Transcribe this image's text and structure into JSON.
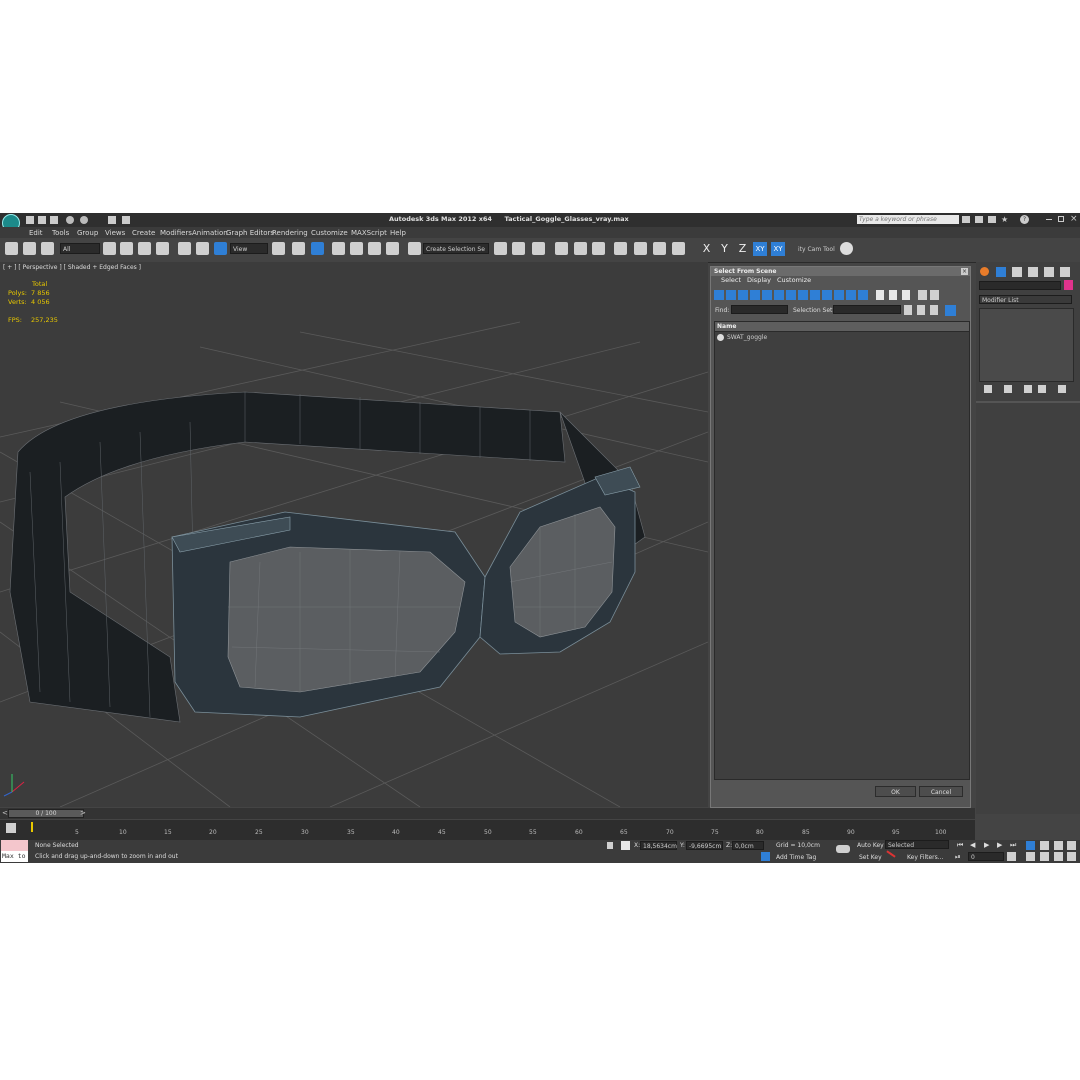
{
  "title": {
    "app": "Autodesk 3ds Max  2012 x64",
    "file": "Tactical_Goggle_Glasses_vray.max",
    "search_placeholder": "Type a keyword or phrase"
  },
  "menu": [
    "Edit",
    "Tools",
    "Group",
    "Views",
    "Create",
    "Modifiers",
    "Animation",
    "Graph Editors",
    "Rendering",
    "Customize",
    "MAXScript",
    "Help"
  ],
  "toolbar": {
    "filter": "All",
    "refcoord": "View",
    "selset": "Create Selection Se",
    "axis": [
      "X",
      "Y",
      "Z",
      "XY",
      "XY"
    ],
    "extra": "ity Cam Tool"
  },
  "viewport": {
    "label": "[ + ] [ Perspective ] [ Shaded + Edged Faces ]",
    "stats_header": "Total",
    "polys_label": "Polys:",
    "polys_value": "7 856",
    "verts_label": "Verts:",
    "verts_value": "4 056",
    "fps_label": "FPS:",
    "fps_value": "257,235"
  },
  "dialog": {
    "title": "Select From Scene",
    "menu": [
      "Select",
      "Display",
      "Customize"
    ],
    "find_label": "Find:",
    "selset_label": "Selection Set:",
    "column": "Name",
    "items": [
      "SWAT_goggle"
    ],
    "ok": "OK",
    "cancel": "Cancel"
  },
  "command_panel": {
    "modifier_list": "Modifier List"
  },
  "timeline": {
    "frame": "0 / 100",
    "ticks": [
      "5",
      "10",
      "15",
      "20",
      "25",
      "30",
      "35",
      "40",
      "45",
      "50",
      "55",
      "60",
      "65",
      "70",
      "75",
      "80",
      "85",
      "90",
      "95",
      "100"
    ]
  },
  "status": {
    "maxscript": "Max to",
    "selection": "None Selected",
    "prompt": "Click and drag up-and-down to zoom in and out",
    "x_label": "X:",
    "x_value": "18,5634cm",
    "y_label": "Y:",
    "y_value": "-9,6695cm",
    "z_label": "Z:",
    "z_value": "0,0cm",
    "grid": "Grid = 10,0cm",
    "add_time_tag": "Add Time Tag",
    "auto_key": "Auto Key",
    "set_key": "Set Key",
    "key_mode": "Selected",
    "key_filters": "Key Filters...",
    "frame_field": "0"
  },
  "colors": {
    "viewport_bg": "#3c3c3c",
    "hud": "#e8c800",
    "accent": "#2f7fd6",
    "mesh": "#1b1f22",
    "frame": "#3a4a55"
  }
}
